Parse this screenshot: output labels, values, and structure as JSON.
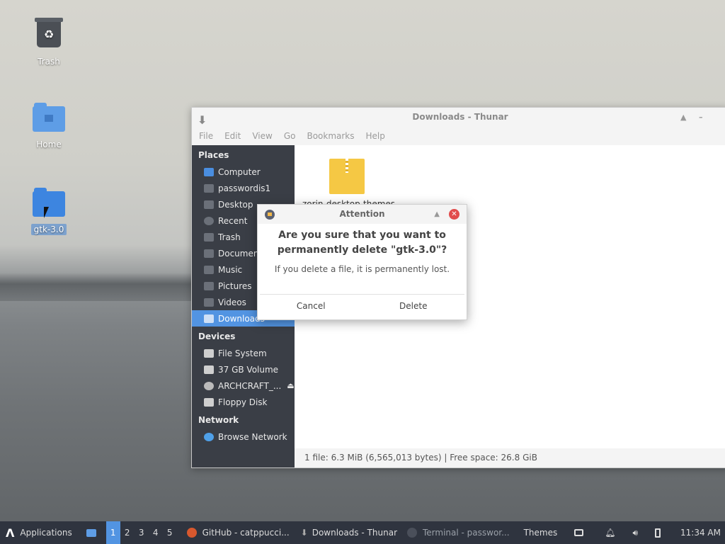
{
  "desktop": {
    "icons": [
      {
        "label": "Trash"
      },
      {
        "label": "Home"
      },
      {
        "label": "gtk-3.0"
      }
    ]
  },
  "thunar": {
    "title": "Downloads - Thunar",
    "menu": [
      "File",
      "Edit",
      "View",
      "Go",
      "Bookmarks",
      "Help"
    ],
    "places_header": "Places",
    "places": [
      "Computer",
      "passwordis1",
      "Desktop",
      "Recent",
      "Trash",
      "Documents",
      "Music",
      "Pictures",
      "Videos",
      "Downloads"
    ],
    "devices_header": "Devices",
    "devices": [
      "File System",
      "37 GB Volume",
      "ARCHCRAFT_...",
      "Floppy Disk"
    ],
    "network_header": "Network",
    "network": [
      "Browse Network"
    ],
    "file_label": "zorin-desktop-themes",
    "status": "1 file: 6.3 MiB (6,565,013 bytes)  |  Free space: 26.8 GiB"
  },
  "dialog": {
    "title": "Attention",
    "heading": "Are you sure that you want to permanently delete \"gtk-3.0\"?",
    "message": "If you delete a file, it is permanently lost.",
    "cancel": "Cancel",
    "delete": "Delete"
  },
  "taskbar": {
    "applications": "Applications",
    "workspaces": [
      "1",
      "2",
      "3",
      "4",
      "5"
    ],
    "tasks": [
      "GitHub - catppucci...",
      "Downloads - Thunar",
      "Terminal - passwor..."
    ],
    "themes": "Themes",
    "clock": "11:34 AM"
  }
}
